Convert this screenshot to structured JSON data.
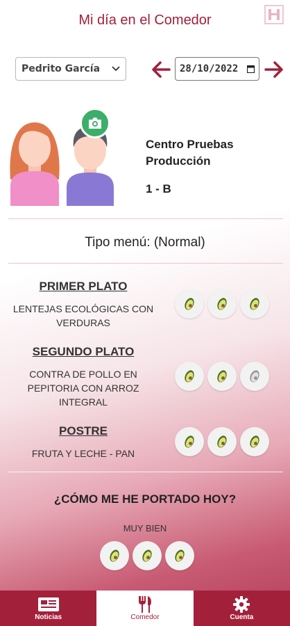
{
  "header": {
    "title": "Mi día en el Comedor",
    "corner_icon": "grid-logo-icon"
  },
  "controls": {
    "child_select": "Pedrito García",
    "date": "28/10/2022",
    "prev_icon": "arrow-left-icon",
    "next_icon": "arrow-right-icon"
  },
  "profile": {
    "school_line1": "Centro Pruebas",
    "school_line2": "Producción",
    "group": "1 - B",
    "camera_icon": "camera-icon"
  },
  "menu": {
    "type_label": "Tipo menú: (Normal)",
    "courses": [
      {
        "title": "PRIMER PLATO",
        "desc1": "LENTEJAS ECOLÓGICAS CON",
        "desc2": "VERDURAS",
        "desc3": ""
      },
      {
        "title": "SEGUNDO PLATO",
        "desc1": "CONTRA DE POLLO EN",
        "desc2": "PEPITORIA CON ARROZ",
        "desc3": "INTEGRAL"
      },
      {
        "title": "POSTRE",
        "desc1": "FRUTA Y LECHE - PAN",
        "desc2": "",
        "desc3": ""
      }
    ],
    "rating_icon": "avocado-icon"
  },
  "behavior": {
    "question": "¿CÓMO ME HE PORTADO HOY?",
    "value": "MUY BIEN"
  },
  "nav": {
    "items": [
      {
        "label": "Noticias",
        "icon": "newspaper-icon"
      },
      {
        "label": "Comedor",
        "icon": "fork-knife-icon"
      },
      {
        "label": "Cuenta",
        "icon": "gear-icon"
      }
    ]
  },
  "colors": {
    "brand": "#a3203b",
    "camera": "#3cae6a",
    "avocado": "#6b8e23"
  }
}
